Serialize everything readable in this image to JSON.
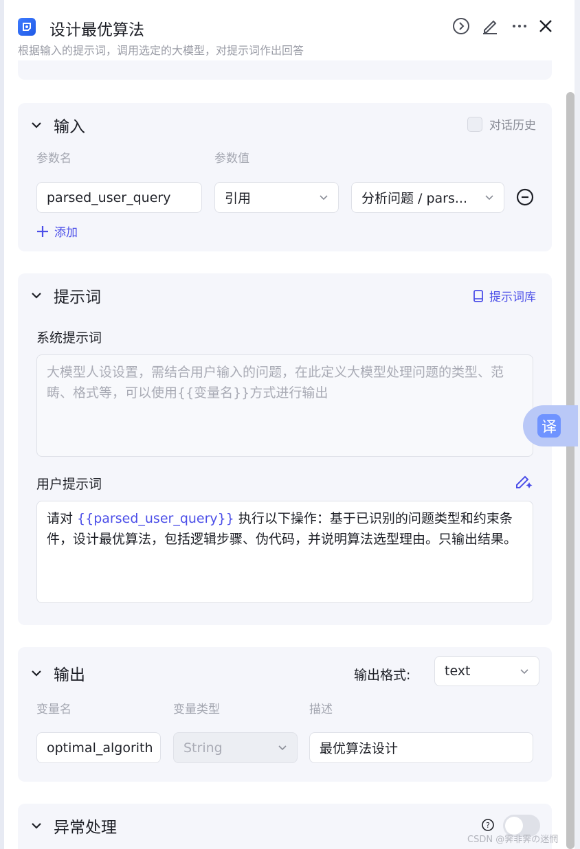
{
  "header": {
    "title": "设计最优算法",
    "subtitle": "根据输入的提示词，调用选定的大模型，对提示词作出回答"
  },
  "input_section": {
    "title": "输入",
    "history_label": "对话历史",
    "col_name": "参数名",
    "col_value": "参数值",
    "param_name": "parsed_user_query",
    "param_type": "引用",
    "param_ref": "分析问题 / pars...",
    "add_label": "添加"
  },
  "prompt_section": {
    "title": "提示词",
    "library_label": "提示词库",
    "system_label": "系统提示词",
    "system_placeholder": "大模型人设设置，需结合用户输入的问题，在此定义大模型处理问题的类型、范畴、格式等，可以使用{{变量名}}方式进行输出",
    "user_label": "用户提示词",
    "user_prefix": "请对 ",
    "user_var": "{{parsed_user_query}}",
    "user_suffix": " 执行以下操作：基于已识别的问题类型和约束条件，设计最优算法，包括逻辑步骤、伪代码，并说明算法选型理由。只输出结果。"
  },
  "output_section": {
    "title": "输出",
    "format_label": "输出格式:",
    "format_value": "text",
    "col_name": "变量名",
    "col_type": "变量类型",
    "col_desc": "描述",
    "var_name": "optimal_algorith",
    "var_type": "String",
    "var_desc": "最优算法设计"
  },
  "error_section": {
    "title": "异常处理"
  },
  "translate_label": "译",
  "watermark": "CSDN @霁非霁の迷惘",
  "colors": {
    "accent": "#4b4ee8",
    "card_bg": "#f5f6fb",
    "logo": "#2f6cf5"
  }
}
